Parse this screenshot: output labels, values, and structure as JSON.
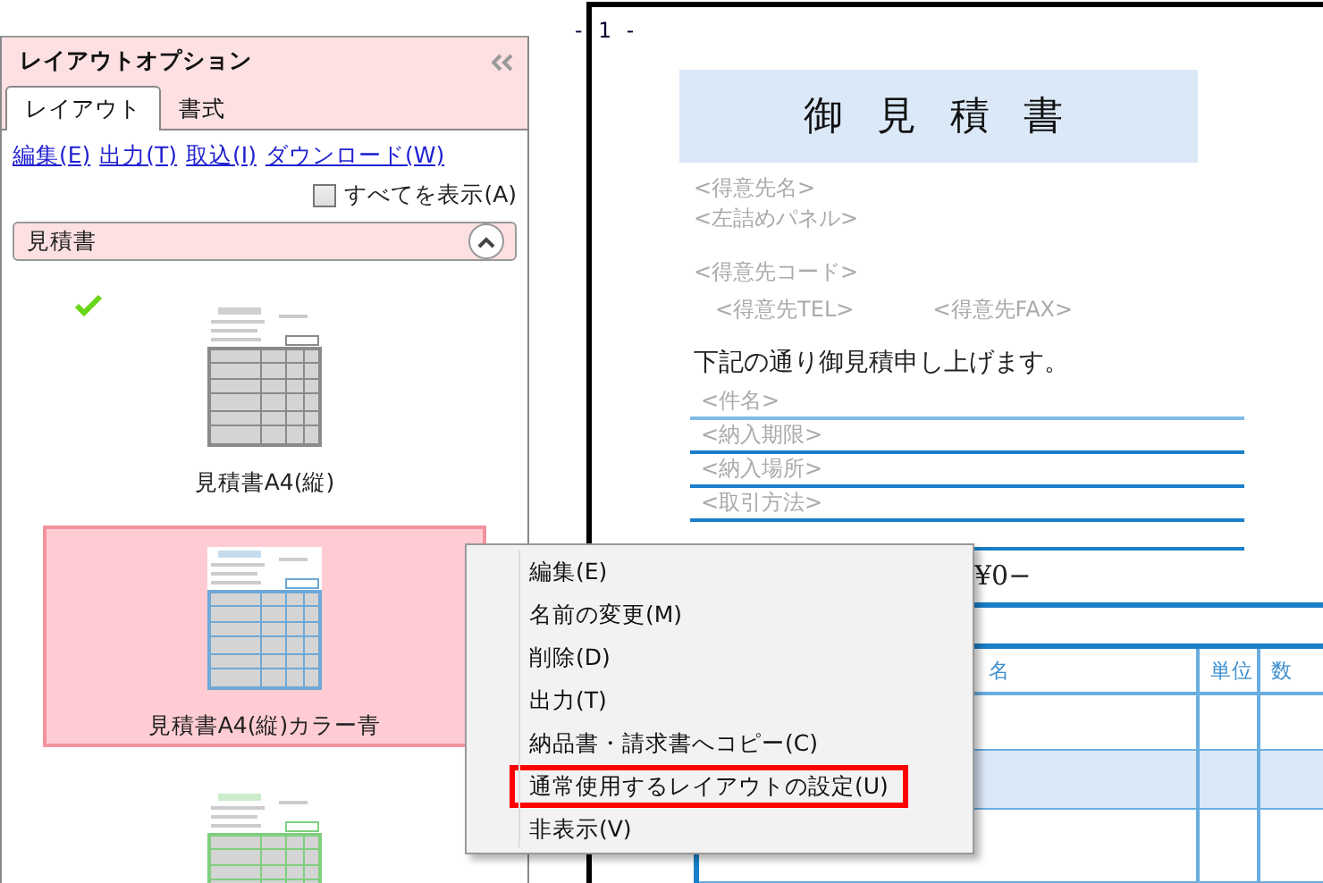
{
  "panel": {
    "title": "レイアウトオプション"
  },
  "tabs": [
    {
      "label": "レイアウト",
      "selected": true
    },
    {
      "label": "書式",
      "selected": false
    }
  ],
  "links": [
    "編集(E)",
    "出力(T)",
    "取込(I)",
    "ダウンロード(W)"
  ],
  "show_all": {
    "label": "すべてを表示(A)",
    "checked": false
  },
  "group": {
    "title": "見積書",
    "expanded": true
  },
  "layouts": [
    {
      "name": "見積書A4(縦)",
      "default": true,
      "selected": false,
      "color": "#8a8a8a"
    },
    {
      "name": "見積書A4(縦)カラー青",
      "default": false,
      "selected": true,
      "color": "#6fa8d6"
    },
    {
      "default": false,
      "selected": false,
      "color": "#7fcf7f"
    }
  ],
  "document": {
    "page_number": "- 1 -",
    "title": "御 見 積 書",
    "customer_name": "<得意先名>",
    "left_panel": "<左詰めパネル>",
    "customer_code": "<得意先コード>",
    "tel": "<得意先TEL>",
    "fax": "<得意先FAX>",
    "greeting": "下記の通り御見積申し上げます。",
    "fields": [
      "<件名>",
      "<納入期限>",
      "<納入場所>",
      "<取引方法>"
    ],
    "amount": "¥0−",
    "table_columns": [
      "名",
      "単位",
      "数"
    ]
  },
  "context_menu": [
    {
      "label": "編集(E)",
      "outlined": false
    },
    {
      "label": "名前の変更(M)",
      "outlined": false
    },
    {
      "label": "削除(D)",
      "outlined": false
    },
    {
      "label": "出力(T)",
      "outlined": false
    },
    {
      "label": "納品書・請求書へコピー(C)",
      "outlined": false
    },
    {
      "label": "通常使用するレイアウトの設定(U)",
      "outlined": true
    },
    {
      "label": "非表示(V)",
      "outlined": false
    }
  ]
}
